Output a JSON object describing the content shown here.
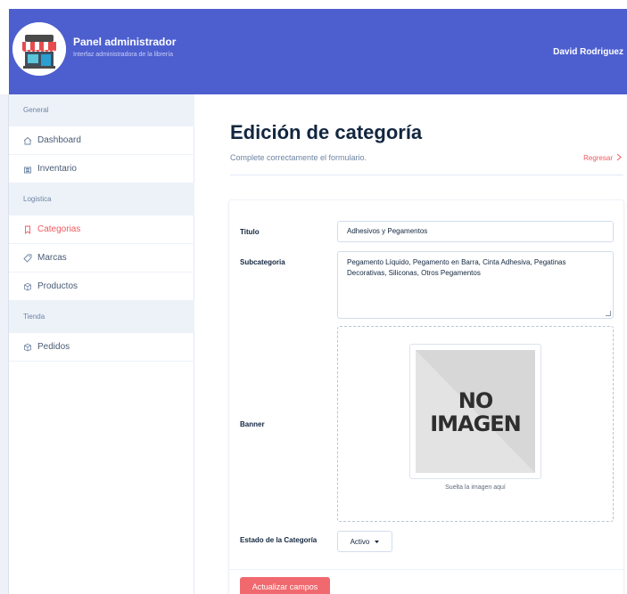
{
  "header": {
    "title": "Panel administrador",
    "subtitle": "Interfaz administradora de la librería",
    "user_name": "David Rodriguez",
    "bg_color": "#4d5fcf"
  },
  "sidebar": {
    "sections": [
      {
        "label": "General",
        "items": [
          {
            "label": "Dashboard",
            "icon": "home-icon",
            "active": false
          },
          {
            "label": "Inventario",
            "icon": "building-icon",
            "active": false
          }
        ]
      },
      {
        "label": "Logistica",
        "items": [
          {
            "label": "Categorias",
            "icon": "bookmark-icon",
            "active": true
          },
          {
            "label": "Marcas",
            "icon": "tag-icon",
            "active": false
          },
          {
            "label": "Productos",
            "icon": "box-icon",
            "active": false
          }
        ]
      },
      {
        "label": "Tienda",
        "items": [
          {
            "label": "Pedidos",
            "icon": "box-icon",
            "active": false
          }
        ]
      }
    ],
    "active_color": "#f0595f"
  },
  "main": {
    "title": "Edición de categoría",
    "subtitle": "Complete correctamente el formulario.",
    "back_label": "Regresar"
  },
  "form": {
    "titulo_label": "Titulo",
    "titulo_value": "Adhesivos y Pegamentos",
    "subcategoria_label": "Subcategoria",
    "subcategoria_value": "Pegamento Líquido, Pegamento en Barra, Cinta Adhesiva, Pegatinas Decorativas, Siliconas, Otros Pegamentos",
    "banner_label": "Banner",
    "placeholder_line1": "NO",
    "placeholder_line2": "IMAGEN",
    "drop_hint": "Suelta la imagen aquí",
    "estado_label": "Estado de la Categoría",
    "estado_value": "Activo",
    "submit_label": "Actualizar campos",
    "submit_color": "#f0696e"
  }
}
